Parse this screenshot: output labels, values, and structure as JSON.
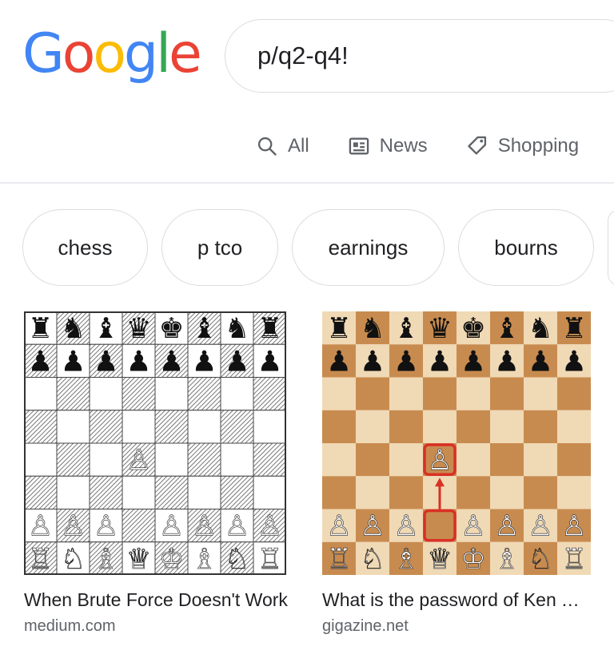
{
  "logo": {
    "letters": [
      "G",
      "o",
      "o",
      "g",
      "l",
      "e"
    ],
    "colors": [
      "#4285F4",
      "#EA4335",
      "#FBBC05",
      "#4285F4",
      "#34A853",
      "#EA4335"
    ]
  },
  "search": {
    "value": "p/q2-q4!"
  },
  "tabs": [
    {
      "label": "All",
      "icon": "search-icon"
    },
    {
      "label": "News",
      "icon": "news-icon"
    },
    {
      "label": "Shopping",
      "icon": "tag-icon"
    }
  ],
  "chips": [
    "chess",
    "p tco",
    "earnings",
    "bourns",
    ""
  ],
  "results": [
    {
      "title": "When Brute Force Doesn't Work",
      "source": "medium.com"
    },
    {
      "title": "What is the password of Ken Thompson",
      "source": "gigazine.net"
    }
  ],
  "board_one": {
    "rows": [
      [
        "♜",
        "♞",
        "♝",
        "♛",
        "♚",
        "♝",
        "♞",
        "♜"
      ],
      [
        "♟",
        "♟",
        "♟",
        "♟",
        "♟",
        "♟",
        "♟",
        "♟"
      ],
      [
        "",
        "",
        "",
        "",
        "",
        "",
        "",
        ""
      ],
      [
        "",
        "",
        "",
        "",
        "",
        "",
        "",
        ""
      ],
      [
        "",
        "",
        "",
        "♙",
        "",
        "",
        "",
        ""
      ],
      [
        "",
        "",
        "",
        "",
        "",
        "",
        "",
        ""
      ],
      [
        "♙",
        "♙",
        "♙",
        "",
        "♙",
        "♙",
        "♙",
        "♙"
      ],
      [
        "♖",
        "♘",
        "♗",
        "♕",
        "♔",
        "♗",
        "♘",
        "♖"
      ]
    ]
  },
  "board_two": {
    "rows": [
      [
        "♜",
        "♞",
        "♝",
        "♛",
        "♚",
        "♝",
        "♞",
        "♜"
      ],
      [
        "♟",
        "♟",
        "♟",
        "♟",
        "♟",
        "♟",
        "♟",
        "♟"
      ],
      [
        "",
        "",
        "",
        "",
        "",
        "",
        "",
        ""
      ],
      [
        "",
        "",
        "",
        "",
        "",
        "",
        "",
        ""
      ],
      [
        "",
        "",
        "",
        "♙",
        "",
        "",
        "",
        ""
      ],
      [
        "",
        "",
        "",
        "",
        "",
        "",
        "",
        ""
      ],
      [
        "♙",
        "♙",
        "♙",
        "",
        "♙",
        "♙",
        "♙",
        "♙"
      ],
      [
        "♖",
        "♘",
        "♗",
        "♕",
        "♔",
        "♗",
        "♘",
        "♖"
      ]
    ],
    "highlight_color": "#d93025",
    "light_square": "#f0d9b5",
    "dark_square": "#c88b4f"
  }
}
